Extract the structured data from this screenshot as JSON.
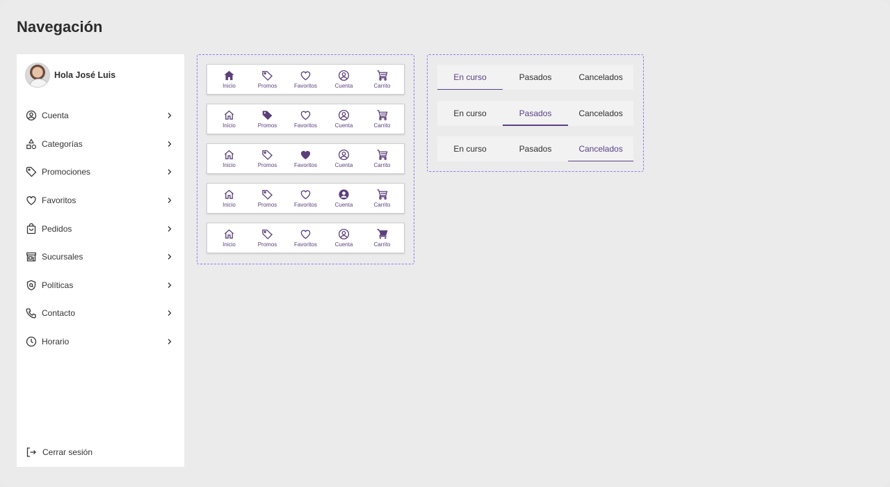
{
  "page": {
    "title": "Navegación"
  },
  "colors": {
    "accent": "#5b3f7a",
    "dashed_border": "#8d7bf0",
    "background": "#ebebeb"
  },
  "sidebar": {
    "greeting": "Hola José Luis",
    "items": [
      {
        "label": "Cuenta",
        "icon": "user-circle-icon"
      },
      {
        "label": "Categorías",
        "icon": "shapes-icon"
      },
      {
        "label": "Promociones",
        "icon": "tag-icon"
      },
      {
        "label": "Favoritos",
        "icon": "heart-icon"
      },
      {
        "label": "Pedidos",
        "icon": "shopping-bag-icon"
      },
      {
        "label": "Sucursales",
        "icon": "store-icon"
      },
      {
        "label": "Políticas",
        "icon": "shield-icon"
      },
      {
        "label": "Contacto",
        "icon": "phone-icon"
      },
      {
        "label": "Horario",
        "icon": "clock-icon"
      }
    ],
    "logout": "Cerrar sesión"
  },
  "bottom_nav": {
    "items": [
      {
        "label": "Inicio",
        "icon": "home-icon"
      },
      {
        "label": "Promos",
        "icon": "tag-icon"
      },
      {
        "label": "Favoritos",
        "icon": "heart-icon"
      },
      {
        "label": "Cuenta",
        "icon": "user-circle-icon"
      },
      {
        "label": "Carrito",
        "icon": "cart-icon"
      }
    ],
    "variants_active_index": [
      0,
      1,
      2,
      3,
      4
    ]
  },
  "order_tabs": {
    "labels": [
      "En curso",
      "Pasados",
      "Cancelados"
    ],
    "variants_active_index": [
      0,
      1,
      2
    ]
  }
}
